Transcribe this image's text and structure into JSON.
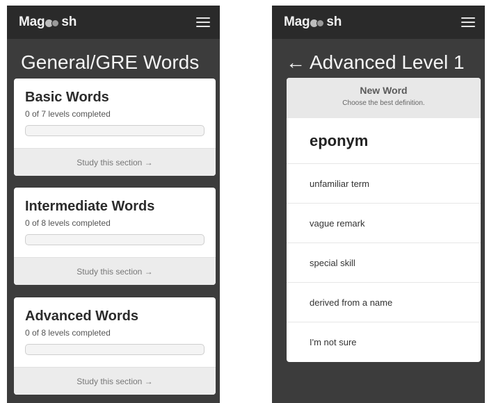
{
  "app": {
    "brand_left": "Mag",
    "brand_right": "sh",
    "logo_icon": "two-circles-logo-icon",
    "menu_icon": "hamburger-menu-icon"
  },
  "left": {
    "title": "General/GRE Words",
    "cards": [
      {
        "title": "Basic Words",
        "subtitle": "0 of 7 levels completed",
        "progress": 0,
        "action": "Study this section →"
      },
      {
        "title": "Intermediate Words",
        "subtitle": "0 of 8 levels completed",
        "progress": 0,
        "action": "Study this section →"
      },
      {
        "title": "Advanced Words",
        "subtitle": "0 of 8 levels completed",
        "progress": 0,
        "action": "Study this section →"
      }
    ]
  },
  "right": {
    "back_arrow": "←",
    "title": "Advanced Level 1",
    "quiz": {
      "header": "New Word",
      "instruction": "Choose the best definition.",
      "word": "eponym",
      "options": [
        "unfamiliar term",
        "vague remark",
        "special skill",
        "derived from a name",
        "I'm not sure"
      ]
    }
  },
  "colors": {
    "topbar": "#2a2a2a",
    "background": "#3c3c3c",
    "card": "#ffffff",
    "card_footer": "#ececec"
  }
}
